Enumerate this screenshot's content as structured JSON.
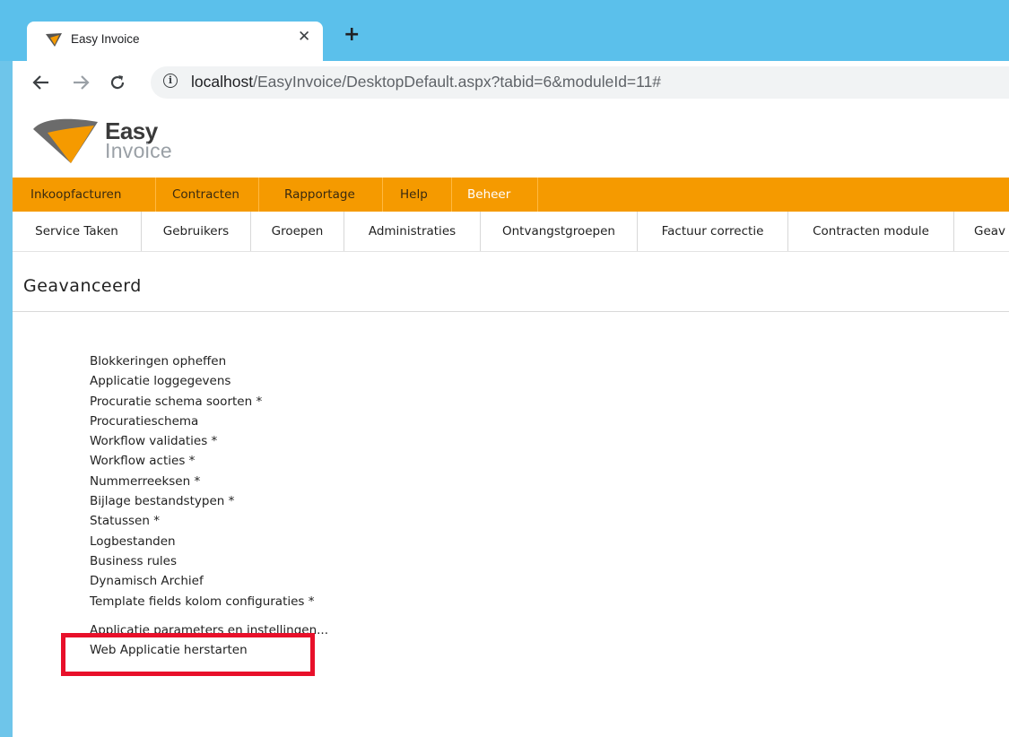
{
  "browser": {
    "tab_title": "Easy Invoice",
    "close_glyph": "✕",
    "new_tab_glyph": "+",
    "url_host": "localhost",
    "url_path": "/EasyInvoice/DesktopDefault.aspx?tabid=6&moduleId=11#",
    "nav_icons": [
      "back-arrow-icon",
      "forward-arrow-icon",
      "reload-icon",
      "info-icon"
    ]
  },
  "logo": {
    "word1": "Easy",
    "word2": "Invoice"
  },
  "main_nav": {
    "items": [
      "Inkoopfacturen",
      "Contracten",
      "Rapportage",
      "Help",
      "Beheer"
    ],
    "active": "Beheer"
  },
  "sub_nav": {
    "items": [
      "Service Taken",
      "Gebruikers",
      "Groepen",
      "Administraties",
      "Ontvangstgroepen",
      "Factuur correctie",
      "Contracten module",
      "Geav"
    ]
  },
  "page_title": "Geavanceerd",
  "links": [
    "Blokkeringen opheffen",
    "Applicatie loggegevens",
    "Procuratie schema soorten *",
    "Procuratieschema",
    "Workflow validaties *",
    "Workflow acties *",
    "Nummerreeksen *",
    "Bijlage bestandstypen *",
    "Statussen *",
    "Logbestanden",
    "Business rules",
    "Dynamisch Archief",
    "Template fields kolom configuraties *",
    "Applicatie parameters en instellingen...",
    "Web Applicatie herstarten"
  ],
  "colors": {
    "chrome_blue": "#5bc0eb",
    "orange_nav": "#f59a00",
    "highlight_red": "#e8102a"
  }
}
